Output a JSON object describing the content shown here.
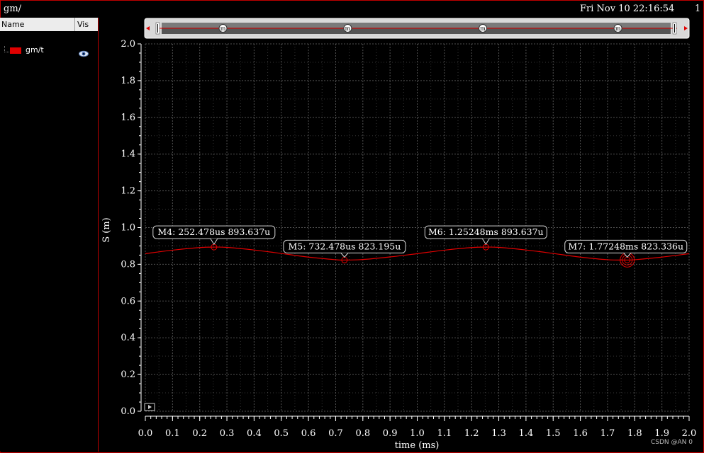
{
  "window": {
    "title": "gm/",
    "datetime": "Fri Nov 10 22:16:54",
    "page_number": "1"
  },
  "legend": {
    "col_name": "Name",
    "col_vis": "Vis",
    "traces": [
      {
        "name": "gm/t",
        "color": "#e00000",
        "visibility_icon": "eye-icon"
      }
    ]
  },
  "colors": {
    "background": "#000000",
    "trace": "#e00000",
    "grid": "#5a5a5a",
    "axis": "#ffffff",
    "frame": "#c00000"
  },
  "watermark": "CSDN @AN 0",
  "chart_data": {
    "type": "line",
    "title": "",
    "xlabel": "time (ms)",
    "ylabel": "S (m)",
    "xlim": [
      0.0,
      2.0
    ],
    "ylim": [
      0.0,
      2.0
    ],
    "xticks": [
      "0.0",
      "0.1",
      "0.2",
      "0.3",
      "0.4",
      "0.5",
      "0.6",
      "0.7",
      "0.8",
      "0.9",
      "1.0",
      "1.1",
      "1.2",
      "1.3",
      "1.4",
      "1.5",
      "1.6",
      "1.7",
      "1.8",
      "1.9",
      "2.0"
    ],
    "yticks": [
      "0.0",
      "0.2",
      "0.4",
      "0.6",
      "0.8",
      "1.0",
      "1.2",
      "1.4",
      "1.6",
      "1.8",
      "2.0"
    ],
    "grid": true,
    "series": [
      {
        "name": "gm/t",
        "x": [
          0.0,
          0.1,
          0.2,
          0.2525,
          0.3,
          0.4,
          0.5,
          0.6,
          0.7,
          0.7325,
          0.8,
          0.9,
          1.0,
          1.1,
          1.2,
          1.2525,
          1.3,
          1.4,
          1.5,
          1.6,
          1.7,
          1.7725,
          1.8,
          1.9,
          2.0
        ],
        "y": [
          0.858,
          0.877,
          0.891,
          0.8936,
          0.892,
          0.878,
          0.859,
          0.839,
          0.825,
          0.8232,
          0.826,
          0.84,
          0.858,
          0.877,
          0.891,
          0.8936,
          0.892,
          0.878,
          0.859,
          0.839,
          0.825,
          0.8233,
          0.825,
          0.839,
          0.858
        ]
      }
    ],
    "markers": [
      {
        "label": "M4: 252.478us 893.637u",
        "x": 0.252478,
        "y": 0.893637
      },
      {
        "label": "M5: 732.478us 823.195u",
        "x": 0.732478,
        "y": 0.823195
      },
      {
        "label": "M6: 1.25248ms 893.637u",
        "x": 1.25248,
        "y": 0.893637
      },
      {
        "label": "M7: 1.77248ms 823.336u",
        "x": 1.77248,
        "y": 0.823336
      }
    ],
    "navigator_marker_glyph": "m"
  }
}
